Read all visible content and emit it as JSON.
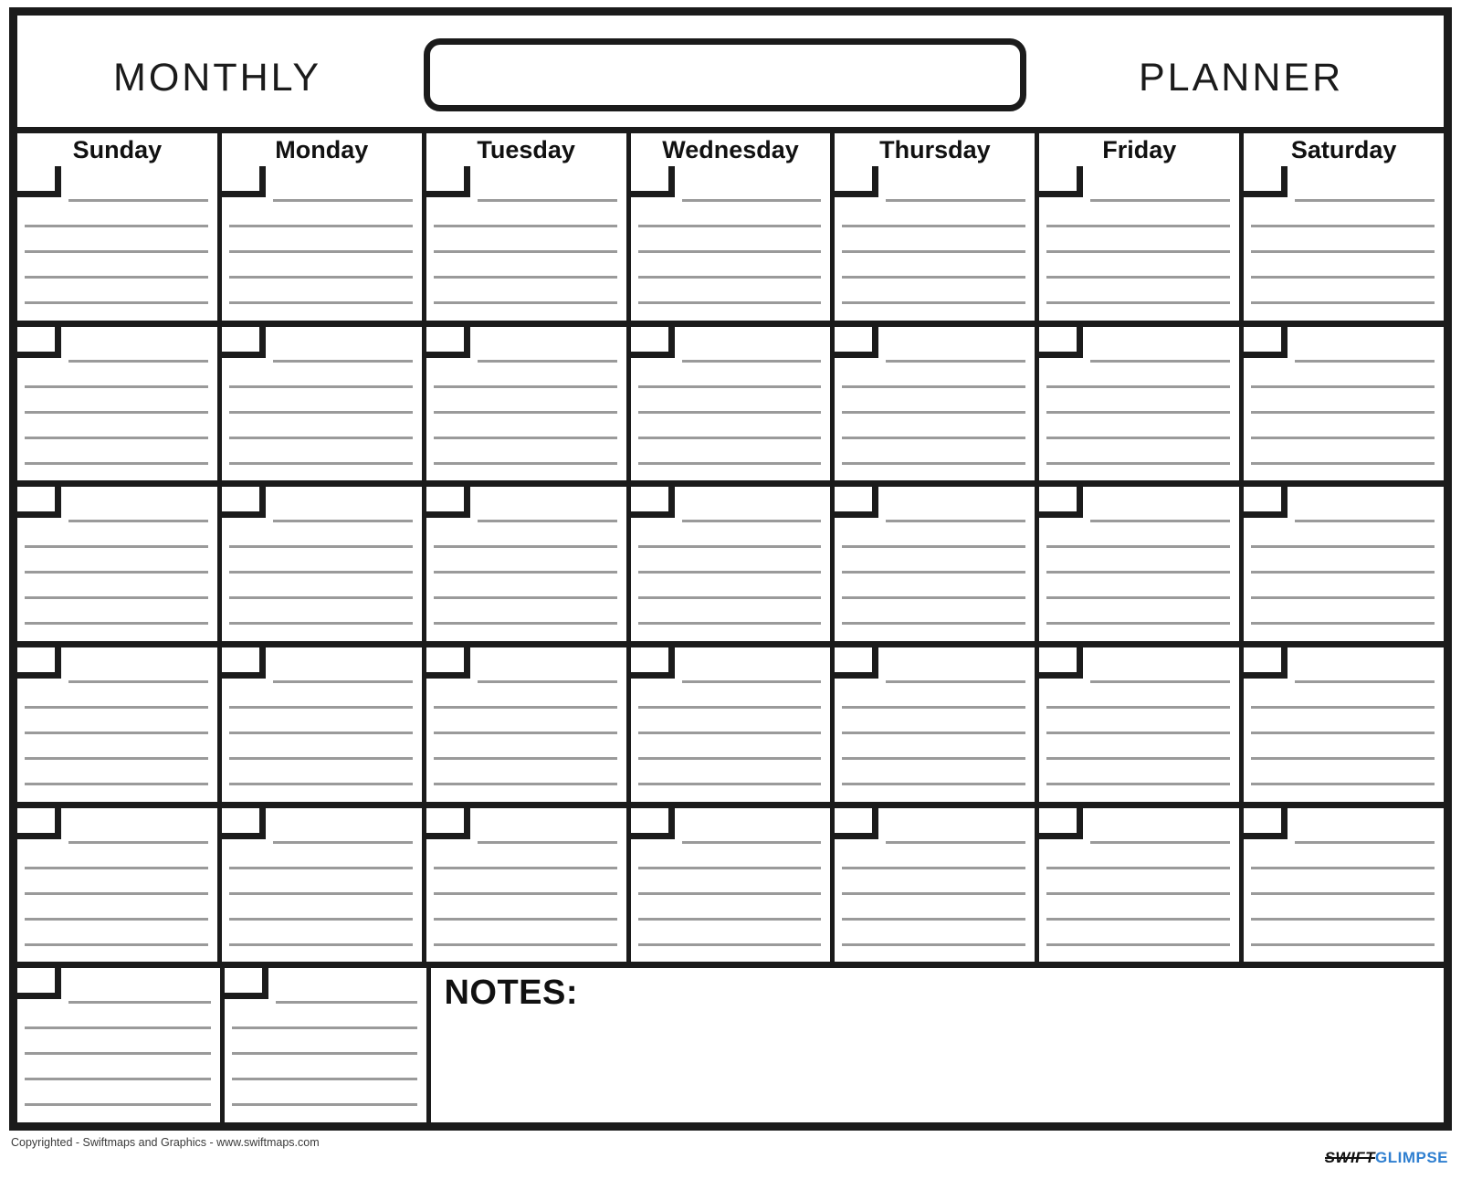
{
  "document": {
    "type": "monthly-planner",
    "title_left": "MONTHLY",
    "title_right": "PLANNER",
    "month_field_value": "",
    "month_field_placeholder": ""
  },
  "weekdays": [
    {
      "label": "Sunday"
    },
    {
      "label": "Monday"
    },
    {
      "label": "Tuesday"
    },
    {
      "label": "Wednesday"
    },
    {
      "label": "Thursday"
    },
    {
      "label": "Friday"
    },
    {
      "label": "Saturday"
    }
  ],
  "grid": {
    "rows": 6,
    "columns": 7,
    "lines_per_cell": 5,
    "date_values": [
      [
        "",
        "",
        "",
        "",
        "",
        "",
        ""
      ],
      [
        "",
        "",
        "",
        "",
        "",
        "",
        ""
      ],
      [
        "",
        "",
        "",
        "",
        "",
        "",
        ""
      ],
      [
        "",
        "",
        "",
        "",
        "",
        "",
        ""
      ],
      [
        "",
        "",
        "",
        "",
        "",
        "",
        ""
      ],
      [
        "",
        ""
      ]
    ]
  },
  "notes": {
    "label": "NOTES:",
    "value": ""
  },
  "footer": {
    "copyright": "Copyrighted - Swiftmaps and Graphics - www.swiftmaps.com",
    "brand_primary": "SWIFT",
    "brand_secondary": "GLIMPSE"
  },
  "colors": {
    "ink": "#1b1b1b",
    "rule": "#9a9a9a",
    "brand_blue": "#2f7fd0",
    "page": "#ffffff"
  }
}
